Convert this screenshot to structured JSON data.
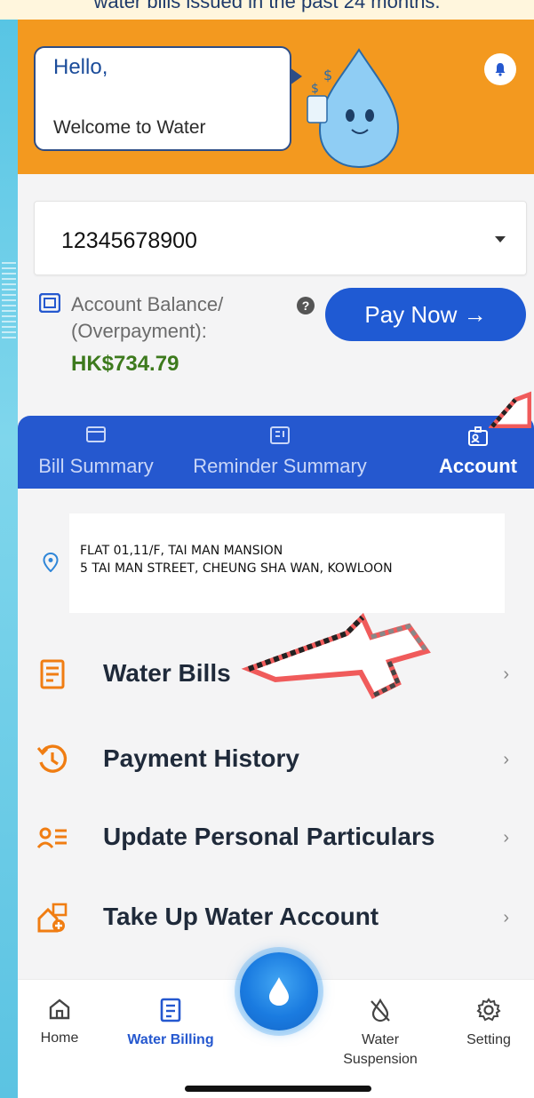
{
  "caption": "water bills issued in the past 24 months.",
  "header": {
    "greeting": "Hello,",
    "welcome": "Welcome to Water"
  },
  "account": {
    "number": "12345678900"
  },
  "balance": {
    "label_line1": "Account Balance/",
    "label_line2": "(Overpayment):",
    "amount": "HK$734.79",
    "help": "?"
  },
  "pay_now": {
    "label": "Pay Now →"
  },
  "tabs": [
    {
      "label": "Bill Summary",
      "icon": "bill-card-icon"
    },
    {
      "label": "Reminder Summary",
      "icon": "reminder-icon"
    },
    {
      "label": "Account",
      "icon": "account-card-icon",
      "active": true
    }
  ],
  "address": {
    "line1": "FLAT 01,11/F, TAI MAN MANSION",
    "line2": "5 TAI MAN STREET, CHEUNG SHA WAN, KOWLOON"
  },
  "menu": [
    {
      "label": "Water Bills",
      "icon": "water-bill-icon"
    },
    {
      "label": "Payment History",
      "icon": "history-icon"
    },
    {
      "label": "Update Personal Particulars",
      "icon": "personal-particulars-icon"
    },
    {
      "label": "Take Up Water Account",
      "icon": "take-up-account-icon"
    }
  ],
  "nav": {
    "home": "Home",
    "billing": "Water Billing",
    "suspension_line1": "Water",
    "suspension_line2": "Suspension",
    "setting": "Setting"
  },
  "colors": {
    "accent": "#2558cf",
    "header": "#f3991f",
    "balance": "#3d7a1d",
    "menu_icon": "#f07d12"
  }
}
